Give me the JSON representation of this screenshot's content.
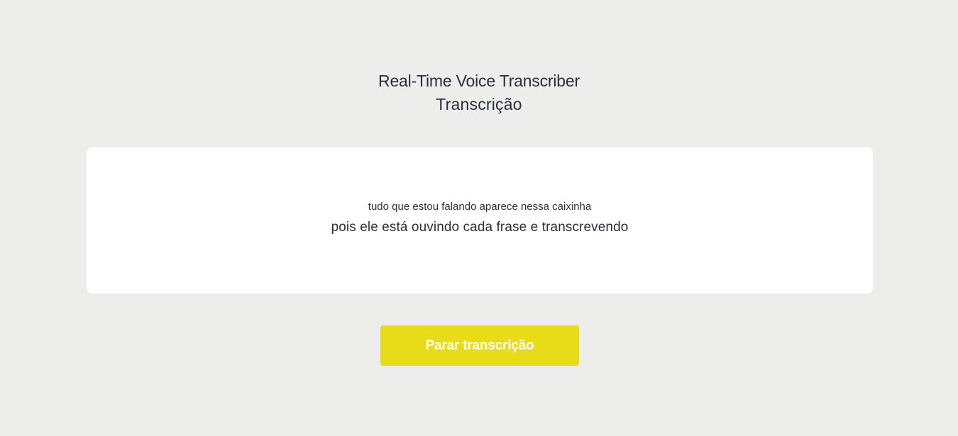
{
  "header": {
    "app_title": "Real-Time Voice Transcriber",
    "page_title": "Transcrição"
  },
  "transcript": {
    "previous_line": "tudo que estou falando aparece nessa caixinha",
    "current_line": "pois ele está ouvindo cada frase e transcrevendo"
  },
  "controls": {
    "stop_label": "Parar transcrição"
  },
  "colors": {
    "background": "#ededeb",
    "card": "#ffffff",
    "accent": "#e8dc18",
    "text": "#2a2f3e"
  }
}
